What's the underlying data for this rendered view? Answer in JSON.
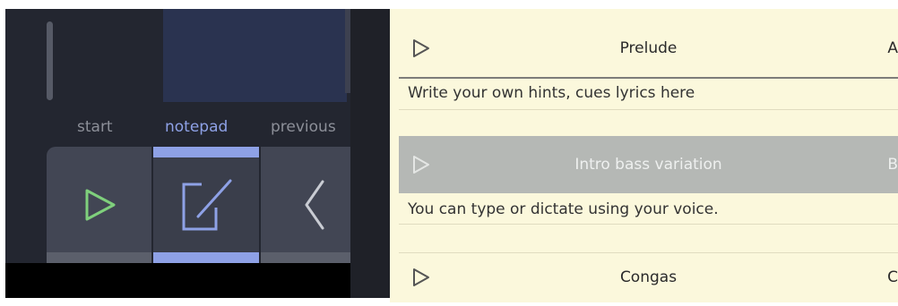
{
  "left_panel": {
    "tabs": [
      {
        "label": "start"
      },
      {
        "label": "notepad"
      },
      {
        "label": "previous"
      }
    ],
    "colors": {
      "start_icon": "#7fd07c",
      "notepad_icon": "#8ea1e6",
      "previous_icon": "#c9ccd3",
      "active_tab": "#8ea1e6"
    }
  },
  "cues": [
    {
      "title": "Prelude",
      "letter": "A",
      "note": "Write your own hints, cues lyrics here",
      "selected": false
    },
    {
      "title": "Intro bass variation",
      "letter": "B",
      "note": "You can type or dictate using your voice.",
      "selected": true
    },
    {
      "title": "Congas",
      "letter": "C",
      "note": "",
      "selected": false
    }
  ]
}
